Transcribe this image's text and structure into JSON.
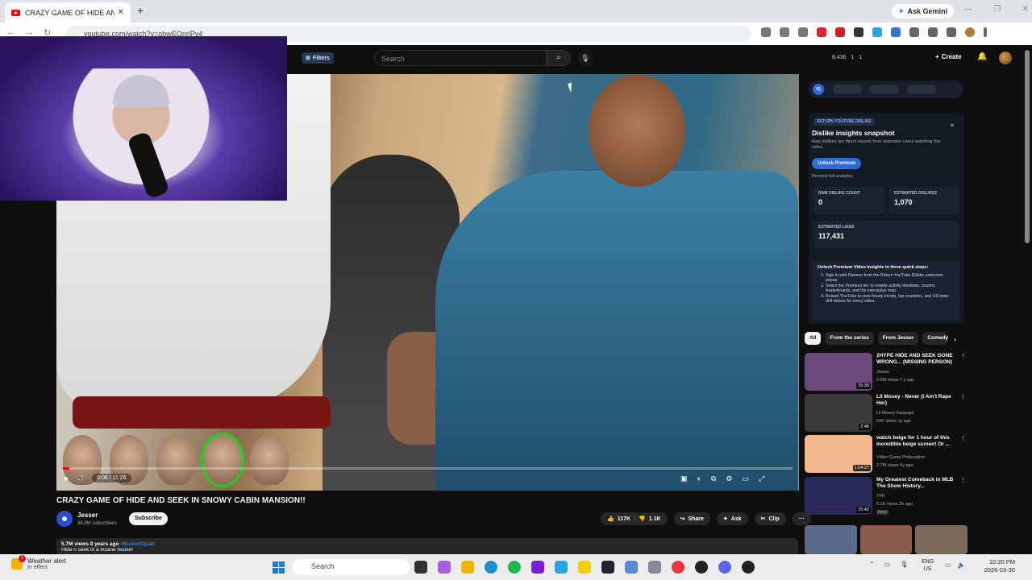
{
  "browser": {
    "tab_title": "CRAZY GAME OF HIDE AND SE",
    "new_tab": "+",
    "url": "youtube.com/watch?v=obwEQnrlPv4",
    "ask_gemini": "Ask Gemini"
  },
  "youtube": {
    "filters_label": "Filters",
    "search_placeholder": "Search",
    "stat_1": "8,436",
    "stat_2": "1",
    "stat_3": "1",
    "create_label": "Create"
  },
  "video": {
    "time": "0:06 / 11:26",
    "progress_fraction": 0.009,
    "title": "CRAZY GAME OF HIDE AND SEEK IN SNOWY CABIN MANSION!!",
    "channel": "Jesser",
    "subscribers": "38.8M subscribers",
    "subscribe_label": "Subscribe",
    "likes": "117K",
    "dislikes": "1.1K",
    "share_label": "Share",
    "ask_label": "Ask",
    "clip_label": "Clip",
    "views_date": "5.7M views  8 years ago",
    "hashtag": "#BucketSquad",
    "description": "Hide n seek in a insane house!"
  },
  "ryd": {
    "badge": "RETURN YOUTUBE DISLIKE",
    "heading": "Dislike insights snapshot",
    "sub": "Raw dislikes are direct reports from extension users watching this video.",
    "unlock": "Unlock Premium",
    "preview": "Preview full analytics",
    "raw_label": "RAW DISLIKE COUNT",
    "raw_value": "0",
    "est_dislikes_label": "ESTIMATED DISLIKES",
    "est_dislikes_value": "1,070",
    "est_likes_label": "ESTIMATED LIKES",
    "est_likes_value": "117,431",
    "steps_title": "Unlock Premium Video Insights in three quick steps:",
    "step1": "Sign in with Patreon from the Return YouTube Dislike extension popup.",
    "step2": "Select the Premium tier to enable activity timelines, country leaderboards, and the interactive map.",
    "step3": "Reload YouTube to view hourly trends, top countries, and US state drill-downs for every video."
  },
  "chips": [
    "All",
    "From the series",
    "From Jesser",
    "Comedy"
  ],
  "recommendations": [
    {
      "title": "2HYPE HIDE AND SEEK GONE WRONG... (MISSING PERSON)",
      "channel": "Jesser",
      "meta": "3.6M views  7 y ago",
      "duration": "15:35",
      "color": "#6a4a7a"
    },
    {
      "title": "Lil Mosey - Never (I Ain't Rape Her)",
      "channel": "Lil Mosey Fanpage",
      "meta": "52K views  1y ago",
      "duration": "2:40",
      "color": "#3a3a3a"
    },
    {
      "title": "watch beige for 1 hour of this incredible beige screen! Or ...",
      "channel": "Video Game Philosopher",
      "meta": "2.7M views  6y ago",
      "duration": "1:04:27",
      "color": "#f2b98f"
    },
    {
      "title": "My Greatest Comeback in MLB The Show History...",
      "channel": "YFK",
      "meta": "8.1K views  2h ago",
      "duration": "15:42",
      "badge": "New",
      "color": "#2a2a5a"
    }
  ],
  "taskbar": {
    "weather_title": "Weather alert",
    "weather_sub": "In effect",
    "search": "Search",
    "lang1": "ENG",
    "lang2": "US",
    "time": "10:20 PM",
    "date": "2026-03-30"
  }
}
